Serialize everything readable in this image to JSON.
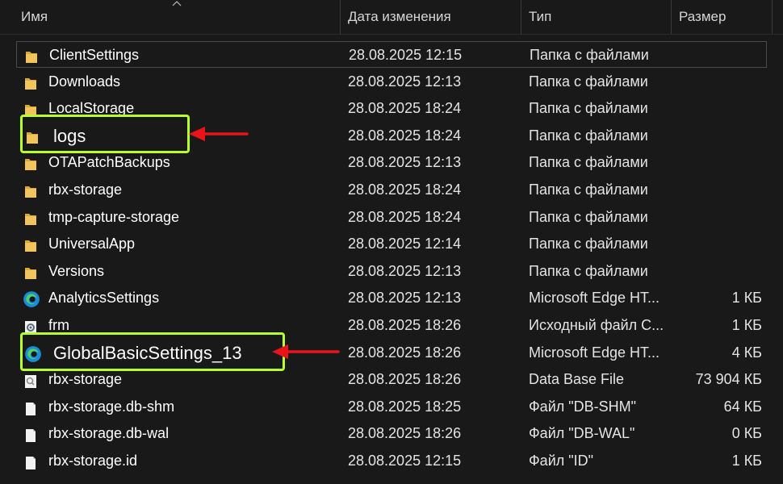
{
  "columns": {
    "name": "Имя",
    "date": "Дата изменения",
    "type": "Тип",
    "size": "Размер"
  },
  "files": [
    {
      "name": "ClientSettings",
      "date": "28.08.2025 12:15",
      "type": "Папка с файлами",
      "size": "",
      "icon": "folder-icon",
      "selected": true
    },
    {
      "name": "Downloads",
      "date": "28.08.2025 12:13",
      "type": "Папка с файлами",
      "size": "",
      "icon": "folder-icon"
    },
    {
      "name": "LocalStorage",
      "date": "28.08.2025 18:24",
      "type": "Папка с файлами",
      "size": "",
      "icon": "folder-icon"
    },
    {
      "name": "logs",
      "date": "28.08.2025 18:24",
      "type": "Папка с файлами",
      "size": "",
      "icon": "folder-icon",
      "highlight": true
    },
    {
      "name": "OTAPatchBackups",
      "date": "28.08.2025 12:13",
      "type": "Папка с файлами",
      "size": "",
      "icon": "folder-icon"
    },
    {
      "name": "rbx-storage",
      "date": "28.08.2025 18:24",
      "type": "Папка с файлами",
      "size": "",
      "icon": "folder-icon"
    },
    {
      "name": "tmp-capture-storage",
      "date": "28.08.2025 18:24",
      "type": "Папка с файлами",
      "size": "",
      "icon": "folder-icon"
    },
    {
      "name": "UniversalApp",
      "date": "28.08.2025 12:14",
      "type": "Папка с файлами",
      "size": "",
      "icon": "folder-icon"
    },
    {
      "name": "Versions",
      "date": "28.08.2025 12:13",
      "type": "Папка с файлами",
      "size": "",
      "icon": "folder-icon"
    },
    {
      "name": "AnalyticsSettings",
      "date": "28.08.2025 12:13",
      "type": "Microsoft Edge HT...",
      "size": "1 КБ",
      "icon": "edge-icon"
    },
    {
      "name": "frm",
      "date": "28.08.2025 18:26",
      "type": "Исходный файл C...",
      "size": "1 КБ",
      "icon": "gear-file-icon"
    },
    {
      "name": "GlobalBasicSettings_13",
      "date": "28.08.2025 18:26",
      "type": "Microsoft Edge HT...",
      "size": "4 КБ",
      "icon": "edge-icon",
      "highlight": true
    },
    {
      "name": "rbx-storage",
      "date": "28.08.2025 18:26",
      "type": "Data Base File",
      "size": "73 904 КБ",
      "icon": "database-file-icon"
    },
    {
      "name": "rbx-storage.db-shm",
      "date": "28.08.2025 18:25",
      "type": "Файл \"DB-SHM\"",
      "size": "64 КБ",
      "icon": "file-icon"
    },
    {
      "name": "rbx-storage.db-wal",
      "date": "28.08.2025 18:26",
      "type": "Файл \"DB-WAL\"",
      "size": "0 КБ",
      "icon": "file-icon"
    },
    {
      "name": "rbx-storage.id",
      "date": "28.08.2025 12:15",
      "type": "Файл \"ID\"",
      "size": "1 КБ",
      "icon": "file-icon"
    }
  ],
  "colors": {
    "background": "#191919",
    "highlight": "#b6ff2a",
    "arrow": "#e8141a",
    "folder": "#f2c55c"
  }
}
